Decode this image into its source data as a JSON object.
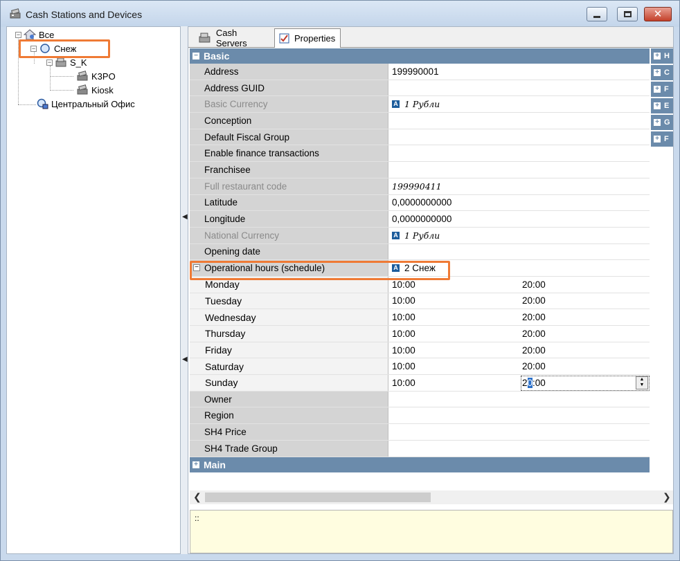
{
  "window": {
    "title": "Cash Stations and Devices"
  },
  "tree": {
    "nodes": [
      {
        "label": "Все"
      },
      {
        "label": "Снеж"
      },
      {
        "label": "S_K"
      },
      {
        "label": "K3PO"
      },
      {
        "label": "Kiosk"
      },
      {
        "label": "Центральный Офис"
      }
    ]
  },
  "tabs": [
    {
      "label": "Cash Servers"
    },
    {
      "label": "Properties"
    }
  ],
  "grid": {
    "basic_header": "Basic",
    "rows": [
      {
        "name": "Address",
        "value": "199990001"
      },
      {
        "name": "Address GUID",
        "value": ""
      },
      {
        "name": "Basic Currency",
        "value": "1 Рубли"
      },
      {
        "name": "Conception",
        "value": ""
      },
      {
        "name": "Default Fiscal Group",
        "value": ""
      },
      {
        "name": "Enable finance transactions",
        "value": ""
      },
      {
        "name": "Franchisee",
        "value": ""
      },
      {
        "name": "Full restaurant code",
        "value": "199990411"
      },
      {
        "name": "Latitude",
        "value": "0,0000000000"
      },
      {
        "name": "Longitude",
        "value": "0,0000000000"
      },
      {
        "name": "National Currency",
        "value": "1 Рубли"
      },
      {
        "name": "Opening date",
        "value": ""
      },
      {
        "name": "Operational hours (schedule)",
        "value": "2 Снеж"
      }
    ],
    "schedule": [
      {
        "day": "Monday",
        "from": "10:00",
        "to": "20:00"
      },
      {
        "day": "Tuesday",
        "from": "10:00",
        "to": "20:00"
      },
      {
        "day": "Wednesday",
        "from": "10:00",
        "to": "20:00"
      },
      {
        "day": "Thursday",
        "from": "10:00",
        "to": "20:00"
      },
      {
        "day": "Friday",
        "from": "10:00",
        "to": "20:00"
      },
      {
        "day": "Saturday",
        "from": "10:00",
        "to": "20:00"
      },
      {
        "day": "Sunday",
        "from": "10:00",
        "to_a": "2",
        "to_sel": "0",
        "to_b": ":00"
      }
    ],
    "rows_after": [
      {
        "name": "Owner",
        "value": ""
      },
      {
        "name": "Region",
        "value": ""
      },
      {
        "name": "SH4 Price",
        "value": ""
      },
      {
        "name": "SH4 Trade Group",
        "value": ""
      }
    ],
    "main_header": "Main",
    "side_headers": [
      "H",
      "C",
      "F",
      "E",
      "G",
      "F"
    ]
  },
  "description": {
    "text": "::"
  },
  "icons": {
    "val_icon_letter": "A",
    "plus": "+",
    "minus": "−"
  }
}
